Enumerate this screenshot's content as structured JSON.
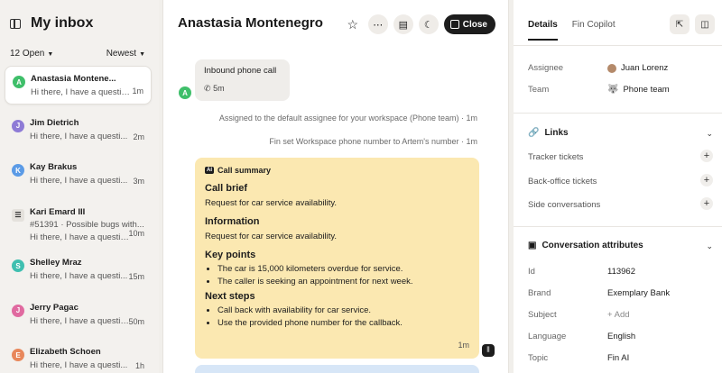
{
  "inbox": {
    "title": "My inbox",
    "filter_open": "12 Open",
    "filter_sort": "Newest",
    "conversations": [
      {
        "initial": "A",
        "color": "#3fbf6a",
        "name": "Anastasia Montene...",
        "preview": "Hi there, I have a questio...",
        "time": "1m"
      },
      {
        "initial": "J",
        "color": "#8e7bd6",
        "name": "Jim Dietrich",
        "preview": "Hi there, I have a questi...",
        "time": "2m"
      },
      {
        "initial": "K",
        "color": "#5b9be6",
        "name": "Kay Brakus",
        "preview": "Hi there, I have a questi...",
        "time": "3m"
      },
      {
        "initial": "",
        "color": "#9a9a9a",
        "name": "Kari Emard III",
        "sub": "#51391 · Possible bugs with...",
        "preview": "Hi there, I have a questio...",
        "time": "10m"
      },
      {
        "initial": "S",
        "color": "#3fbfb0",
        "name": "Shelley Mraz",
        "preview": "Hi there, I have a questi...",
        "time": "15m"
      },
      {
        "initial": "J",
        "color": "#e06aa0",
        "name": "Jerry Pagac",
        "preview": "Hi there, I have a questio...",
        "time": "50m"
      },
      {
        "initial": "E",
        "color": "#e8875b",
        "name": "Elizabeth Schoen",
        "preview": "Hi there, I have a questi...",
        "time": "1h"
      }
    ]
  },
  "conversation": {
    "title": "Anastasia Montenegro",
    "close_label": "Close",
    "call_title": "Inbound phone call",
    "call_duration": "5m",
    "sys_msgs": [
      "Assigned to the default assignee for your workspace (Phone team) · 1m",
      "Fin set Workspace phone number to Artem's number · 1m"
    ],
    "summary": {
      "badge": "AI",
      "label": "Call summary",
      "brief_h": "Call brief",
      "brief": "Request for car service availability.",
      "info_h": "Information",
      "info": "Request for car service availability.",
      "points_h": "Key points",
      "points": [
        "The car is 15,000 kilometers overdue for service.",
        "The caller is seeking an appointment for next week."
      ],
      "steps_h": "Next steps",
      "steps": [
        "Call back with availability for car service.",
        "Use the provided phone number for the callback."
      ],
      "time": "1m"
    }
  },
  "details": {
    "tabs": [
      "Details",
      "Fin Copilot"
    ],
    "assignee_label": "Assignee",
    "assignee": "Juan Lorenz",
    "team_label": "Team",
    "team": "Phone team",
    "links_h": "Links",
    "links": [
      "Tracker tickets",
      "Back-office tickets",
      "Side conversations"
    ],
    "attrs_h": "Conversation attributes",
    "attrs": [
      {
        "k": "Id",
        "v": "113962"
      },
      {
        "k": "Brand",
        "v": "Exemplary Bank"
      },
      {
        "k": "Subject",
        "v": "+ Add"
      },
      {
        "k": "Language",
        "v": "English"
      },
      {
        "k": "Topic",
        "v": "Fin AI"
      }
    ]
  }
}
